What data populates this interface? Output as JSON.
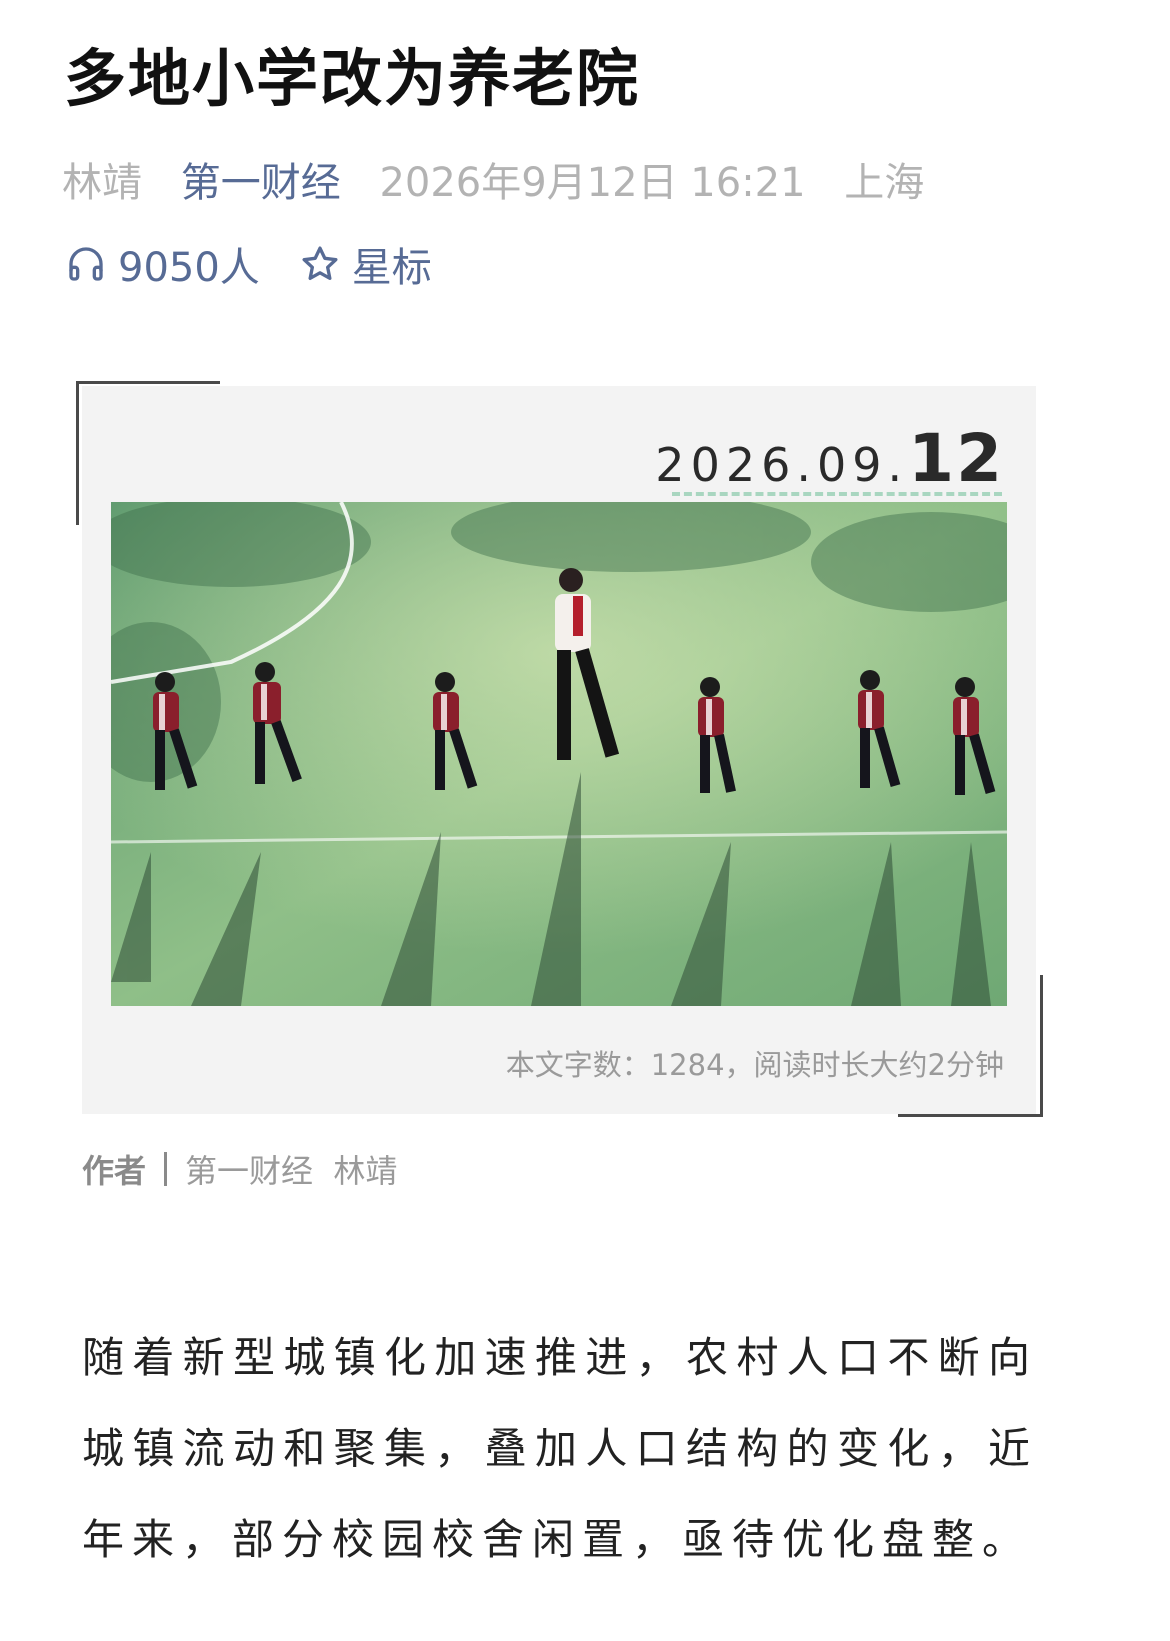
{
  "article": {
    "title": "多地小学改为养老院",
    "author": "林靖",
    "account": "第一财经",
    "datetime": "2026年9月12日 16:21",
    "location": "上海",
    "listeners": "9050人",
    "star_label": "星标"
  },
  "card": {
    "date_prefix": "2026.09.",
    "date_day": "12",
    "word_count": "本文字数：1284，阅读时长大约2分钟"
  },
  "byline": {
    "label": "作者",
    "value": "第一财经  林靖"
  },
  "body": {
    "paragraph": "随着新型城镇化加速推进，农村人口不断向城镇流动和聚集，叠加人口结构的变化，近年来，部分校园校舍闲置，亟待优化盘整。"
  },
  "colors": {
    "link": "#576b95",
    "meta_gray": "#b3b3b3",
    "card_bg": "#f3f3f3",
    "accent_dash": "#a9d6c0"
  },
  "icons": {
    "listen": "headphones-icon",
    "star": "star-outline-icon"
  }
}
